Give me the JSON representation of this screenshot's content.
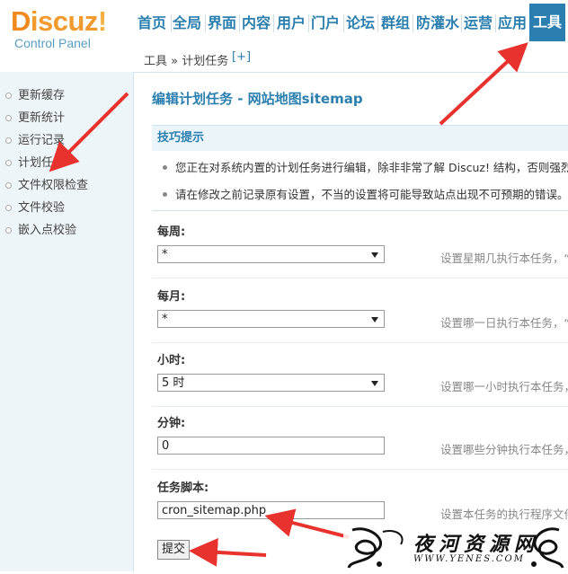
{
  "logo": {
    "word_d": "D",
    "word_rest": "iscuz",
    "word_bang": "!",
    "sub": "Control Panel"
  },
  "nav": {
    "items": [
      "首页",
      "全局",
      "界面",
      "内容",
      "用户",
      "门户",
      "论坛",
      "群组",
      "防灌水",
      "运营",
      "应用",
      "工具"
    ],
    "active": "工具"
  },
  "breadcrumb": {
    "text": "工具 » 计划任务",
    "add": "[+]"
  },
  "sidebar": {
    "items": [
      "更新缓存",
      "更新统计",
      "运行记录",
      "计划任务",
      "文件权限检查",
      "文件校验",
      "嵌入点校验"
    ]
  },
  "main": {
    "title": "编辑计划任务 - 网站地图sitemap",
    "tips": {
      "heading": "技巧提示",
      "lines": [
        "您正在对系统内置的计划任务进行编辑，除非非常了解 Discuz! 结构，否则强烈建议",
        "请在修改之前记录原有设置，不当的设置将可能导致站点出现不可预期的错误。"
      ]
    },
    "fields": [
      {
        "label": "每周:",
        "value": "*",
        "hint": "设置星期几执行本任务，“*”"
      },
      {
        "label": "每月:",
        "value": "*",
        "hint": "设置哪一日执行本任务，“*”"
      },
      {
        "label": "小时:",
        "value": "5 时",
        "hint": "设置哪一小时执行本任务，"
      },
      {
        "label": "分钟:",
        "value": "0",
        "hint": "设置哪些分钟执行本任务，"
      },
      {
        "label": "任务脚本:",
        "value": "cron_sitemap.php",
        "hint": "设置本任务的执行程序文件"
      }
    ],
    "submit_label": "提交"
  },
  "watermark": {
    "cn": "夜河资源网",
    "en": "WWW.YENES.COM"
  },
  "colors": {
    "accent": "#2b7fae",
    "logo_orange": "#f08a1e",
    "annotation_red": "#e8322d"
  },
  "icons": [
    "select-arrow-icon",
    "bullet-icon",
    "red-arrow-annotation"
  ]
}
